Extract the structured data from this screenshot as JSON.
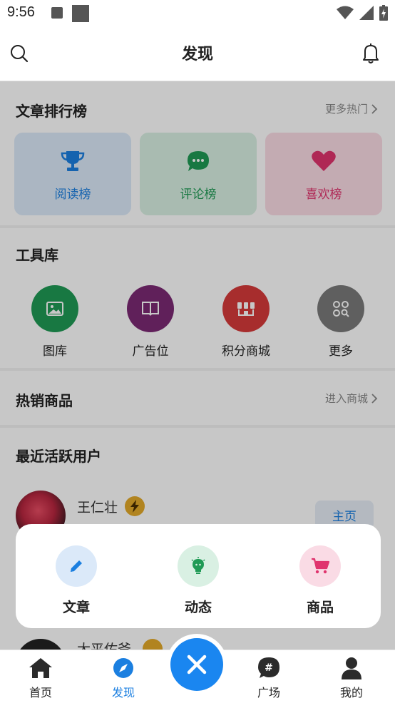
{
  "status_bar": {
    "time": "9:56"
  },
  "header": {
    "title": "发现"
  },
  "articles": {
    "title": "文章排行榜",
    "more": "更多热门",
    "cards": [
      {
        "label": "阅读榜",
        "icon": "trophy-icon",
        "color": "#1b7fe0",
        "bg": "#dbe9f9"
      },
      {
        "label": "评论榜",
        "icon": "comment-icon",
        "color": "#1f9a55",
        "bg": "#d9f0e3"
      },
      {
        "label": "喜欢榜",
        "icon": "heart-icon",
        "color": "#e0346e",
        "bg": "#fadbe5"
      }
    ]
  },
  "tools": {
    "title": "工具库",
    "items": [
      {
        "label": "图库",
        "icon": "image-icon",
        "color": "#1f9a55"
      },
      {
        "label": "广告位",
        "icon": "book-icon",
        "color": "#7b2a74"
      },
      {
        "label": "积分商城",
        "icon": "store-icon",
        "color": "#d63a3a"
      },
      {
        "label": "更多",
        "icon": "more-grid-icon",
        "color": "#7a7a7a"
      }
    ]
  },
  "hot_goods": {
    "title": "热销商品",
    "more": "进入商城"
  },
  "active_users": {
    "title": "最近活跃用户",
    "user": {
      "name": "王仁壮",
      "home_button": "主页"
    },
    "next_user": {
      "name": "大平佑爷"
    }
  },
  "popup": {
    "items": [
      {
        "label": "文章",
        "icon": "pen-icon",
        "color": "#1b7fe0",
        "bg": "#dbe9f9"
      },
      {
        "label": "动态",
        "icon": "bulb-icon",
        "color": "#1f9a55",
        "bg": "#d9f0e3"
      },
      {
        "label": "商品",
        "icon": "cart-icon",
        "color": "#e0346e",
        "bg": "#fadbe5"
      }
    ]
  },
  "bottom_nav": {
    "items": [
      {
        "label": "首页",
        "icon": "home-icon"
      },
      {
        "label": "发现",
        "icon": "compass-icon",
        "active": true
      },
      {
        "label": "广场",
        "icon": "hashtag-icon"
      },
      {
        "label": "我的",
        "icon": "person-icon"
      }
    ],
    "active_color": "#1b7fe0"
  }
}
